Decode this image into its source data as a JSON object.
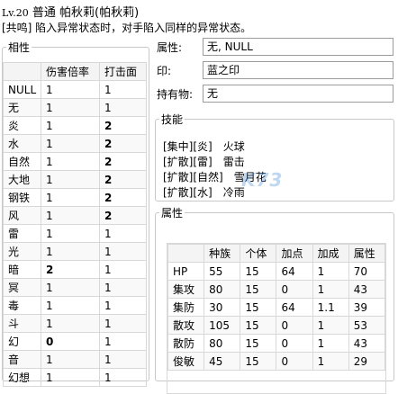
{
  "header": {
    "level": "Lv.20",
    "difficulty": "普通",
    "name": "帕秋莉(帕秋莉)",
    "description": "[共鸣] 陷入异常状态时，对手陷入同样的异常状态。"
  },
  "affinity": {
    "legend": "相性",
    "columns": [
      "",
      "伤害倍率",
      "打击面"
    ],
    "rows": [
      {
        "type": "NULL",
        "damage": "1",
        "hits": "1",
        "bold": false
      },
      {
        "type": "无",
        "damage": "1",
        "hits": "1",
        "bold": false
      },
      {
        "type": "炎",
        "damage": "1",
        "hits": "2",
        "bold": true
      },
      {
        "type": "水",
        "damage": "1",
        "hits": "2",
        "bold": true
      },
      {
        "type": "自然",
        "damage": "1",
        "hits": "2",
        "bold": true
      },
      {
        "type": "大地",
        "damage": "1",
        "hits": "2",
        "bold": true
      },
      {
        "type": "钢铁",
        "damage": "1",
        "hits": "2",
        "bold": true
      },
      {
        "type": "风",
        "damage": "1",
        "hits": "2",
        "bold": true
      },
      {
        "type": "雷",
        "damage": "1",
        "hits": "1",
        "bold": false
      },
      {
        "type": "光",
        "damage": "1",
        "hits": "1",
        "bold": false
      },
      {
        "type": "暗",
        "damage": "2",
        "hits": "1",
        "bold": true
      },
      {
        "type": "冥",
        "damage": "1",
        "hits": "1",
        "bold": false
      },
      {
        "type": "毒",
        "damage": "1",
        "hits": "1",
        "bold": false
      },
      {
        "type": "斗",
        "damage": "1",
        "hits": "1",
        "bold": false
      },
      {
        "type": "幻",
        "damage": "0",
        "hits": "1",
        "bold": true
      },
      {
        "type": "音",
        "damage": "1",
        "hits": "1",
        "bold": false
      },
      {
        "type": "幻想",
        "damage": "1",
        "hits": "1",
        "bold": false
      }
    ]
  },
  "info": {
    "attribute_label": "属性:",
    "attribute_value": "无, NULL",
    "seal_label": "印:",
    "seal_value": "蓝之印",
    "item_label": "持有物:",
    "item_value": "无"
  },
  "skills": {
    "legend": "技能",
    "lines": [
      "[集中][炎]　火球",
      "[扩散][雷]　雷击",
      "[扩散][自然]　雪月花",
      "[扩散][水]　冷雨"
    ]
  },
  "stats": {
    "legend": "属性",
    "columns": [
      "",
      "种族",
      "个体",
      "加点",
      "加成",
      "属性"
    ],
    "rows": [
      [
        "HP",
        "55",
        "15",
        "64",
        "1",
        "70"
      ],
      [
        "集攻",
        "80",
        "15",
        "0",
        "1",
        "43"
      ],
      [
        "集防",
        "30",
        "15",
        "64",
        "1.1",
        "39"
      ],
      [
        "散攻",
        "105",
        "15",
        "0",
        "1",
        "53"
      ],
      [
        "散防",
        "80",
        "15",
        "0",
        "1",
        "43"
      ],
      [
        "俊敏",
        "45",
        "15",
        "0",
        "1",
        "29"
      ]
    ]
  },
  "watermark": "K73"
}
